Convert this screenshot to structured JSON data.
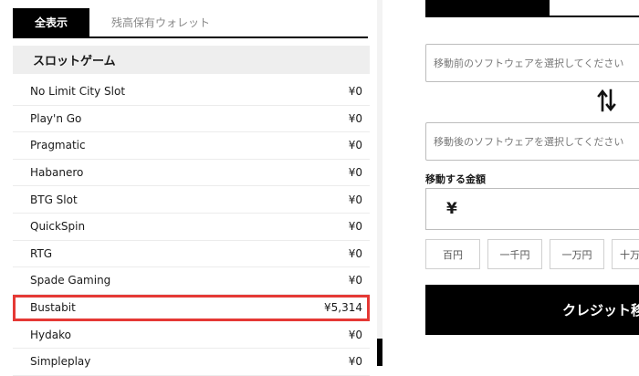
{
  "tabs": {
    "all": "全表示",
    "balance_wallet": "残高保有ウォレット"
  },
  "section": {
    "title": "スロットゲーム"
  },
  "providers": [
    {
      "name": "No Limit City Slot",
      "amount": "¥0"
    },
    {
      "name": "Play'n Go",
      "amount": "¥0"
    },
    {
      "name": "Pragmatic",
      "amount": "¥0"
    },
    {
      "name": "Habanero",
      "amount": "¥0"
    },
    {
      "name": "BTG Slot",
      "amount": "¥0"
    },
    {
      "name": "QuickSpin",
      "amount": "¥0"
    },
    {
      "name": "RTG",
      "amount": "¥0"
    },
    {
      "name": "Spade Gaming",
      "amount": "¥0"
    },
    {
      "name": "Bustabit",
      "amount": "¥5,314",
      "highlighted": true
    },
    {
      "name": "Hydako",
      "amount": "¥0"
    },
    {
      "name": "Simpleplay",
      "amount": "¥0"
    }
  ],
  "transfer": {
    "from_placeholder": "移動前のソフトウェアを選択してください",
    "to_placeholder": "移動後のソフトウェアを選択してください",
    "swap_icon": "swap-vertical-icon",
    "amount_label": "移動する金額",
    "currency_symbol": "¥",
    "quick_amounts": [
      "百円",
      "一千円",
      "一万円",
      "十万"
    ],
    "submit_label": "クレジット移"
  },
  "colors": {
    "highlight": "#e53935",
    "accent": "#000000"
  }
}
